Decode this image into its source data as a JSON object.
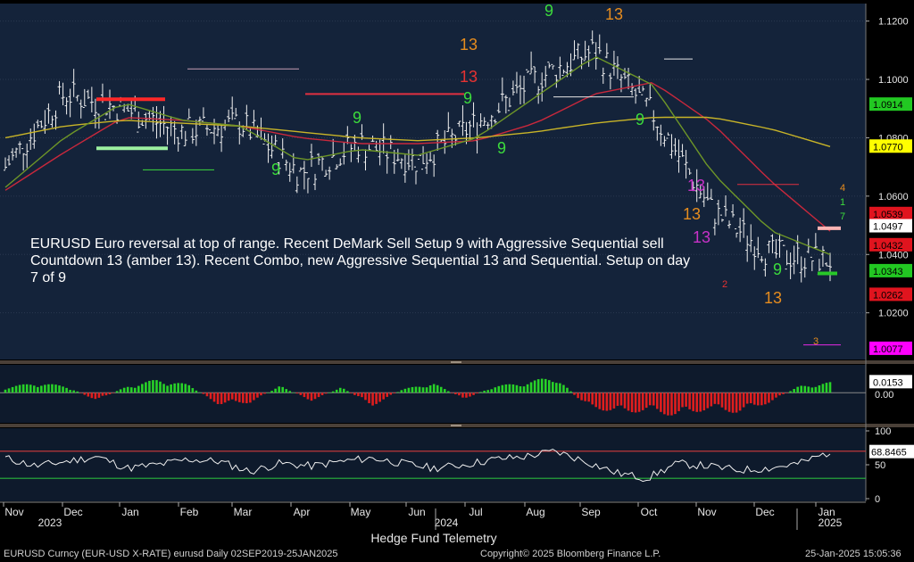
{
  "annotation": "EURUSD Euro reversal at top of range.  Recent DeMark Sell Setup 9 with Aggressive Sequential sell Countdown 13 (amber 13). Recent Combo, new Aggressive Sequential 13 and Sequential. Setup on day 7 of 9",
  "credit": "Hedge Fund Telemetry",
  "footer": {
    "left": "EURUSD Curncy (EUR-USD X-RATE) eurusd  Daily 02SEP2019-25JAN2025",
    "center": "Copyright© 2025 Bloomberg Finance L.P.",
    "right": "25-Jan-2025 15:05:36"
  },
  "colors": {
    "price_bg": "#14233a",
    "close_label": "#ffffff",
    "green_label": "#22c822",
    "yellow_label": "#ffff00",
    "red_label": "#e0141e",
    "magenta_label": "#ff00ff",
    "ma_red": "#c8283c",
    "ma_yellow": "#c8b428",
    "ma_green": "#6e9628",
    "setup_green": "#3cdc3c",
    "setup_red": "#e63232",
    "countdown_amber": "#e68c1e",
    "combo_magenta": "#c832c8"
  },
  "chart_data": [
    {
      "type": "line",
      "panel": "price",
      "x": [
        "Nov",
        "Dec",
        "Jan",
        "Feb",
        "Mar",
        "Apr",
        "May",
        "Jun",
        "Jul",
        "Aug",
        "Sep",
        "Oct",
        "Nov",
        "Dec",
        "Jan"
      ],
      "year_labels": [
        "2023",
        "2024",
        "2025"
      ],
      "series": [
        {
          "values": [
            1.07,
            1.095,
            1.09,
            1.082,
            1.085,
            1.068,
            1.078,
            1.072,
            1.085,
            1.1,
            1.11,
            1.088,
            1.055,
            1.04,
            1.038
          ]
        },
        {
          "values": [
            1.062,
            1.075,
            1.087,
            1.086,
            1.084,
            1.08,
            1.078,
            1.078,
            1.079,
            1.085,
            1.095,
            1.099,
            1.085,
            1.065,
            1.048
          ]
        },
        {
          "values": [
            1.08,
            1.084,
            1.086,
            1.085,
            1.084,
            1.082,
            1.08,
            1.079,
            1.08,
            1.082,
            1.085,
            1.087,
            1.087,
            1.083,
            1.077
          ]
        },
        {
          "values": [
            1.063,
            1.08,
            1.092,
            1.086,
            1.084,
            1.072,
            1.076,
            1.074,
            1.08,
            1.094,
            1.108,
            1.098,
            1.068,
            1.048,
            1.04
          ]
        }
      ],
      "ylim": [
        1.004,
        1.126
      ],
      "y_ticks": [
        1.02,
        1.04,
        1.06,
        1.08,
        1.1,
        1.12
      ],
      "value_labels": [
        {
          "value": "1.0914",
          "color": "green_label"
        },
        {
          "value": "1.0770",
          "color": "yellow_label"
        },
        {
          "value": "1.0539",
          "color": "red_label"
        },
        {
          "value": "1.0497",
          "color": "close_label"
        },
        {
          "value": "1.0432",
          "color": "red_label"
        },
        {
          "value": "1.0343",
          "color": "green_label"
        },
        {
          "value": "1.0262",
          "color": "red_label"
        },
        {
          "value": "1.0077",
          "color": "magenta_label"
        }
      ],
      "demark_marks": [
        {
          "text": "9",
          "color": "setup_green"
        },
        {
          "text": "13",
          "color": "countdown_amber"
        },
        {
          "text": "13",
          "color": "countdown_amber"
        },
        {
          "text": "13",
          "color": "setup_red"
        },
        {
          "text": "9",
          "color": "setup_green"
        },
        {
          "text": "9",
          "color": "setup_green"
        },
        {
          "text": "9",
          "color": "setup_green"
        },
        {
          "text": "9",
          "color": "setup_green"
        },
        {
          "text": "9",
          "color": "setup_green"
        },
        {
          "text": "13",
          "color": "countdown_amber"
        },
        {
          "text": "13",
          "color": "combo_magenta"
        },
        {
          "text": "13",
          "color": "combo_magenta"
        },
        {
          "text": "13",
          "color": "countdown_amber"
        },
        {
          "text": "9",
          "color": "setup_green"
        },
        {
          "text": "4",
          "color": "countdown_amber"
        },
        {
          "text": "1",
          "color": "setup_green"
        },
        {
          "text": "7",
          "color": "setup_green"
        },
        {
          "text": "3",
          "color": "countdown_amber"
        },
        {
          "text": "2",
          "color": "setup_red"
        }
      ]
    },
    {
      "type": "bar",
      "panel": "oscillator",
      "x_range": [
        "Nov 2023",
        "Jan 2025"
      ],
      "values": [
        0.008,
        0.015,
        0.01,
        -0.012,
        0.01,
        0.02,
        0.012,
        -0.018,
        -0.015,
        0.01,
        -0.012,
        0.008,
        -0.02,
        0.005,
        0.015,
        -0.01,
        0.01,
        0.015,
        0.025,
        -0.02,
        -0.03,
        -0.028,
        -0.035,
        -0.025,
        -0.03,
        -0.015,
        0.01,
        0.0153
      ],
      "value_labels": [
        "0.0153",
        "0.00"
      ]
    },
    {
      "type": "line",
      "panel": "rsi",
      "values": [
        60,
        48,
        55,
        62,
        45,
        50,
        58,
        55,
        40,
        52,
        48,
        55,
        60,
        52,
        45,
        50,
        58,
        62,
        70,
        55,
        38,
        30,
        52,
        48,
        42,
        45,
        52,
        68.8465
      ],
      "y_ticks": [
        0,
        50,
        100
      ],
      "reference_lines": [
        30,
        70
      ],
      "value_labels": [
        "68.8465"
      ]
    }
  ]
}
